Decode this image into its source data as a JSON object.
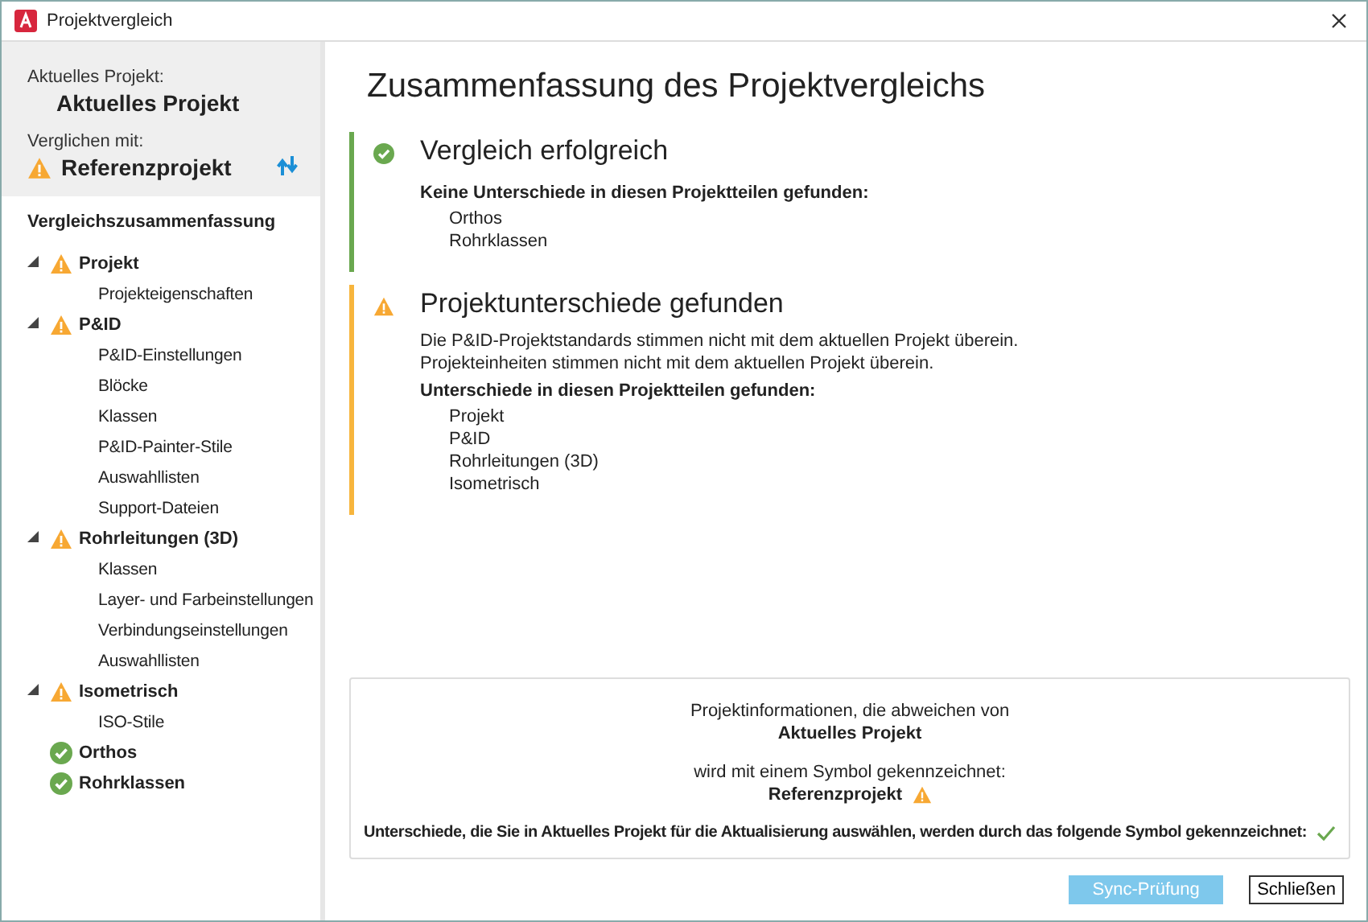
{
  "window": {
    "title": "Projektvergleich"
  },
  "project_info": {
    "current_label": "Aktuelles Projekt:",
    "current_value": "Aktuelles Projekt",
    "compared_label": "Verglichen mit:",
    "compared": {
      "value": "Referenzprojekt",
      "kind": "warning"
    }
  },
  "tree": {
    "heading": "Vergleichszusammenfassung",
    "items": [
      {
        "label": "Projekt",
        "kind": "warning",
        "expanded": true,
        "children": [
          {
            "label": "Projekteigenschaften"
          }
        ]
      },
      {
        "label": "P&ID",
        "kind": "warning",
        "expanded": true,
        "children": [
          {
            "label": "P&ID-Einstellungen"
          },
          {
            "label": "Blöcke"
          },
          {
            "label": "Klassen"
          },
          {
            "label": "P&ID-Painter-Stile"
          },
          {
            "label": "Auswahllisten"
          },
          {
            "label": "Support-Dateien"
          }
        ]
      },
      {
        "label": "Rohrleitungen (3D)",
        "kind": "warning",
        "expanded": true,
        "children": [
          {
            "label": "Klassen"
          },
          {
            "label": "Layer- und Farbeinstellungen"
          },
          {
            "label": "Verbindungseinstellungen"
          },
          {
            "label": "Auswahllisten"
          }
        ]
      },
      {
        "label": "Isometrisch",
        "kind": "warning",
        "expanded": true,
        "children": [
          {
            "label": "ISO-Stile"
          }
        ]
      },
      {
        "label": "Orthos",
        "kind": "ok",
        "expanded": false
      },
      {
        "label": "Rohrklassen",
        "kind": "ok",
        "expanded": false
      }
    ]
  },
  "summary": {
    "title": "Zusammenfassung des Projektvergleichs",
    "sections": [
      {
        "kind": "success",
        "heading": "Vergleich erfolgreich",
        "list_heading": "Keine Unterschiede in diesen Projektteilen gefunden:",
        "items": [
          "Orthos",
          "Rohrklassen"
        ]
      },
      {
        "kind": "warning",
        "heading": "Projektunterschiede gefunden",
        "messages": [
          "Die P&ID-Projektstandards stimmen nicht mit dem aktuellen Projekt überein.",
          "Projekteinheiten stimmen nicht mit dem aktuellen Projekt überein."
        ],
        "list_heading": "Unterschiede in diesen Projektteilen gefunden:",
        "items": [
          "Projekt",
          "P&ID",
          "Rohrleitungen (3D)",
          "Isometrisch"
        ]
      }
    ]
  },
  "legend": {
    "line1": "Projektinformationen, die abweichen von",
    "current": "Aktuelles Projekt",
    "line2": "wird mit einem Symbol gekennzeichnet:",
    "reference": "Referenzprojekt",
    "line3": "Unterschiede, die Sie in Aktuelles Projekt für die Aktualisierung auswählen, werden durch das folgende Symbol gekennzeichnet:"
  },
  "buttons": [
    {
      "label": "Sync-Prüfung",
      "disabled": true
    },
    {
      "label": "Schließen",
      "disabled": false
    }
  ]
}
